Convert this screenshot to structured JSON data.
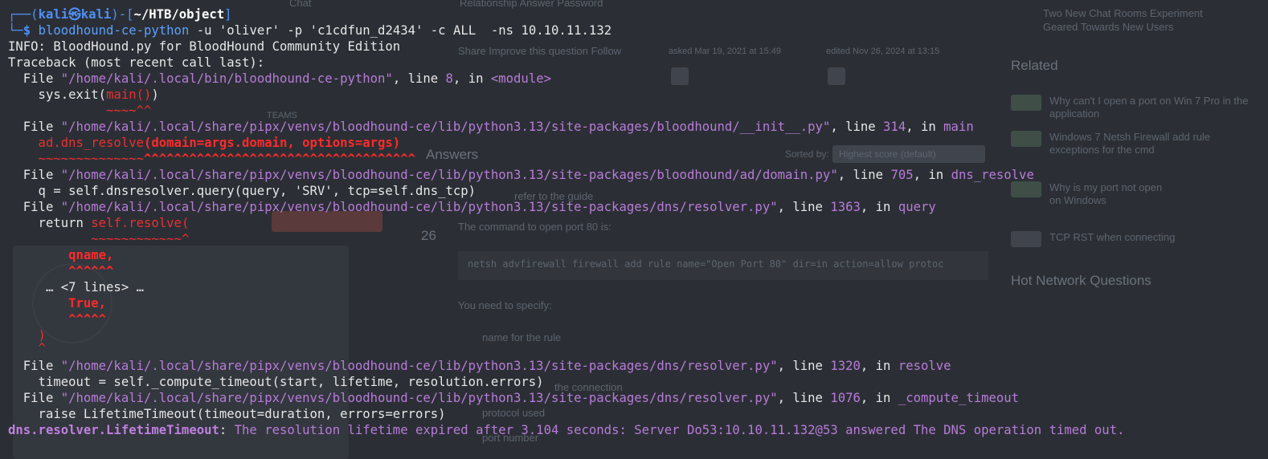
{
  "background_page": {
    "top_text": "Chat",
    "top_tabs": "Relationship   Answer   Password",
    "right_item_top": "Two New Chat Rooms Experiment",
    "right_item_top2": "Geared Towards New Users",
    "share_line": "Share  Improve this question  Follow",
    "asked": "asked Mar 19, 2021 at 15:49",
    "edited": "edited Nov 26, 2024 at 13:15",
    "related_heading": "Related",
    "answers_heading": "Answers",
    "sorted_by": "Sorted by:",
    "sort_value": "Highest score (default)",
    "refer_text": "refer to the guide",
    "vote_count": "26",
    "command_intro": "The command to open port 80 is:",
    "code_text": "netsh advfirewall firewall add rule name=\"Open Port 80\" dir=in action=allow protoc",
    "specify_text": "You need to specify:",
    "bullet_1": "name for the rule",
    "bullet_2": "the connection",
    "bullet_3": "protocol used",
    "bullet_4": "port number",
    "hot_heading": "Hot Network Questions",
    "related_1": "Why can't I open a port on Win 7 Pro in the",
    "related_1b": "application",
    "related_2": "Windows 7 Netsh Firewall add rule",
    "related_2b": "exceptions for the cmd",
    "related_3": "Why is my port not open",
    "related_3b": "on Windows",
    "related_4": "TCP RST when connecting",
    "teams_label": "TEAMS"
  },
  "terminal": {
    "prompt": {
      "corner_top": "┌──(",
      "user": "kali",
      "at": "㉿",
      "host": "kali",
      "mid": ")-[",
      "path": "~/HTB/object",
      "end": "]",
      "corner_bottom": "└─",
      "dollar": "$ "
    },
    "command": {
      "program": "bloodhound-ce-python",
      "args_1": " -u ",
      "user_value": "'oliver'",
      "args_2": " -p ",
      "pass_value": "'c1cdfun_d2434'",
      "args_3": " -c ALL  -ns 10.10.11.132"
    },
    "info_line": "INFO: BloodHound.py for BloodHound Community Edition",
    "traceback_header": "Traceback (most recent call last):",
    "frames": [
      {
        "pre": "  File ",
        "path": "\"/home/kali/.local/bin/bloodhound-ce-python\"",
        "mid": ", line ",
        "line": "8",
        "in": ", in ",
        "func": "<module>"
      },
      {
        "pre": "  File ",
        "path": "\"/home/kali/.local/share/pipx/venvs/bloodhound-ce/lib/python3.13/site-packages/bloodhound/__init__.py\"",
        "mid": ", line ",
        "line": "314",
        "in": ", in ",
        "func": "main"
      },
      {
        "pre": "  File ",
        "path": "\"/home/kali/.local/share/pipx/venvs/bloodhound-ce/lib/python3.13/site-packages/bloodhound/ad/domain.py\"",
        "mid": ", line ",
        "line": "705",
        "in": ", in ",
        "func": "dns_resolve"
      },
      {
        "pre": "  File ",
        "path": "\"/home/kali/.local/share/pipx/venvs/bloodhound-ce/lib/python3.13/site-packages/dns/resolver.py\"",
        "mid": ", line ",
        "line": "1363",
        "in": ", in ",
        "func": "query"
      },
      {
        "pre": "  File ",
        "path": "\"/home/kali/.local/share/pipx/venvs/bloodhound-ce/lib/python3.13/site-packages/dns/resolver.py\"",
        "mid": ", line ",
        "line": "1320",
        "in": ", in ",
        "func": "resolve"
      },
      {
        "pre": "  File ",
        "path": "\"/home/kali/.local/share/pipx/venvs/bloodhound-ce/lib/python3.13/site-packages/dns/resolver.py\"",
        "mid": ", line ",
        "line": "1076",
        "in": ", in ",
        "func": "_compute_timeout"
      }
    ],
    "code_lines": {
      "sys_exit_a": "    sys.exit(",
      "sys_exit_b": "main()",
      "sys_exit_c": ")",
      "carets_1a": "             ~~~~",
      "carets_1b": "^^",
      "dns_resolve_a": "    ad.dns_resolve",
      "dns_resolve_b": "(domain=args.domain, options=args)",
      "carets_2a": "    ~~~~~~~~~~~~~~",
      "carets_2b": "^^^^^^^^^^^^^^^^^^^^^^^^^^^^^^^^^^^^",
      "query_line": "    q = self.dnsresolver.query(query, 'SRV', tcp=self.dns_tcp)",
      "return_a": "    return ",
      "return_b": "self.resolve(",
      "carets_3a": "           ~~~~~~~~~~~~",
      "carets_3b": "^",
      "qname": "        qname,",
      "qname_carets": "        ^^^^^^",
      "folded": "     … <7 lines> …",
      "true_line": "        True,",
      "true_carets": "        ^^^^^",
      "close_paren": "    )",
      "close_caret": "    ^",
      "timeout_line": "    timeout = self._compute_timeout(start, lifetime, resolution.errors)",
      "raise_line": "    raise LifetimeTimeout(timeout=duration, errors=errors)"
    },
    "error": {
      "type": "dns.resolver.LifetimeTimeout",
      "sep": ": ",
      "message": "The resolution lifetime expired after 3.104 seconds: Server Do53:10.10.11.132@53 answered The DNS operation timed out."
    }
  }
}
